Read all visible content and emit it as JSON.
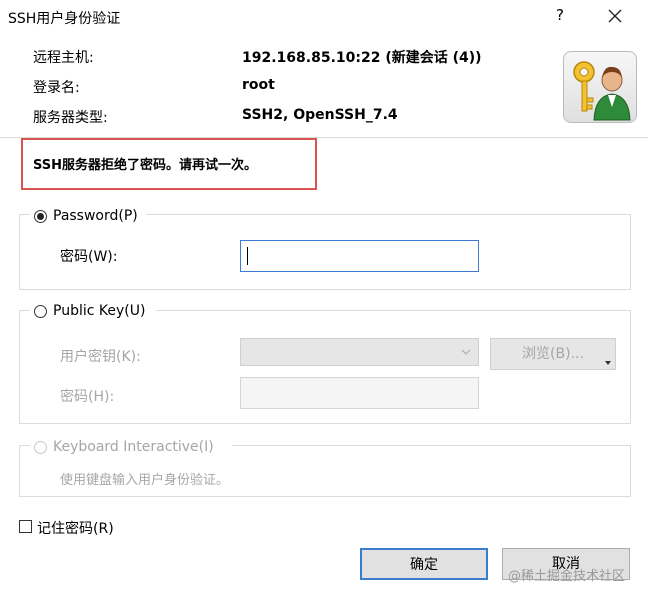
{
  "window": {
    "title": "SSH用户身份验证",
    "help_label": "?",
    "close_icon": "close-icon"
  },
  "info": {
    "host_label": "远程主机:",
    "host_value": "192.168.85.10:22 (新建会话 (4))",
    "login_label": "登录名:",
    "login_value": "root",
    "server_type_label": "服务器类型:",
    "server_type_value": "SSH2, OpenSSH_7.4",
    "app_icon": "user-key-icon"
  },
  "error": {
    "message": "SSH服务器拒绝了密码。请再试一次。",
    "highlight_color": "#d9534f"
  },
  "password_group": {
    "radio_label": "Password(P)",
    "selected": true,
    "field_label": "密码(W):",
    "field_value": ""
  },
  "publickey_group": {
    "radio_label": "Public Key(U)",
    "selected": false,
    "user_key_label": "用户密钥(K):",
    "user_key_value": "",
    "browse_label": "浏览(B)...",
    "passphrase_label": "密码(H):",
    "passphrase_value": ""
  },
  "keyboard_group": {
    "radio_label": "Keyboard Interactive(I)",
    "selected": false,
    "description": "使用键盘输入用户身份验证。"
  },
  "remember": {
    "label": "记住密码(R)",
    "checked": false
  },
  "buttons": {
    "ok_label": "确定",
    "cancel_label": "取消"
  },
  "watermark": "@稀土掘金技术社区",
  "colors": {
    "accent": "#3b7bd0",
    "disabled_text": "#a6a6a6"
  }
}
